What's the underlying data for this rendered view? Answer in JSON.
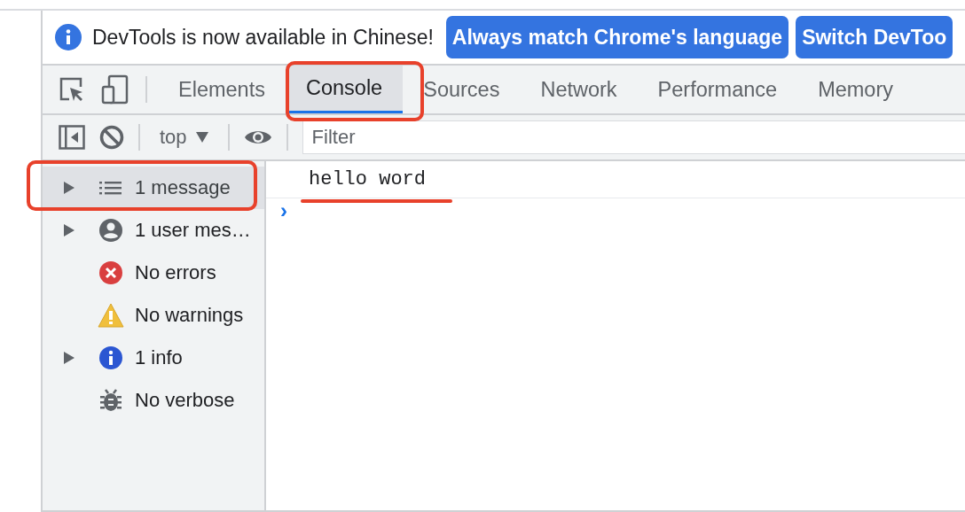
{
  "infobar": {
    "message": "DevTools is now available in Chinese!",
    "buttons": [
      "Always match Chrome's language",
      "Switch DevToo"
    ]
  },
  "tabs": [
    {
      "label": "Elements",
      "selected": false
    },
    {
      "label": "Console",
      "selected": true
    },
    {
      "label": "Sources",
      "selected": false
    },
    {
      "label": "Network",
      "selected": false
    },
    {
      "label": "Performance",
      "selected": false
    },
    {
      "label": "Memory",
      "selected": false
    }
  ],
  "toolbar": {
    "context": "top",
    "filter": {
      "placeholder": "Filter"
    }
  },
  "sidebar": {
    "items": [
      {
        "kind": "messages",
        "label": "1 message",
        "expandable": true,
        "selected": true
      },
      {
        "kind": "user",
        "label": "1 user mes…",
        "expandable": true,
        "selected": false
      },
      {
        "kind": "errors",
        "label": "No errors",
        "expandable": false,
        "selected": false
      },
      {
        "kind": "warnings",
        "label": "No warnings",
        "expandable": false,
        "selected": false
      },
      {
        "kind": "info",
        "label": "1 info",
        "expandable": true,
        "selected": false
      },
      {
        "kind": "verbose",
        "label": "No verbose",
        "expandable": false,
        "selected": false
      }
    ]
  },
  "console": {
    "lines": [
      "hello word"
    ],
    "prompt": "›"
  }
}
